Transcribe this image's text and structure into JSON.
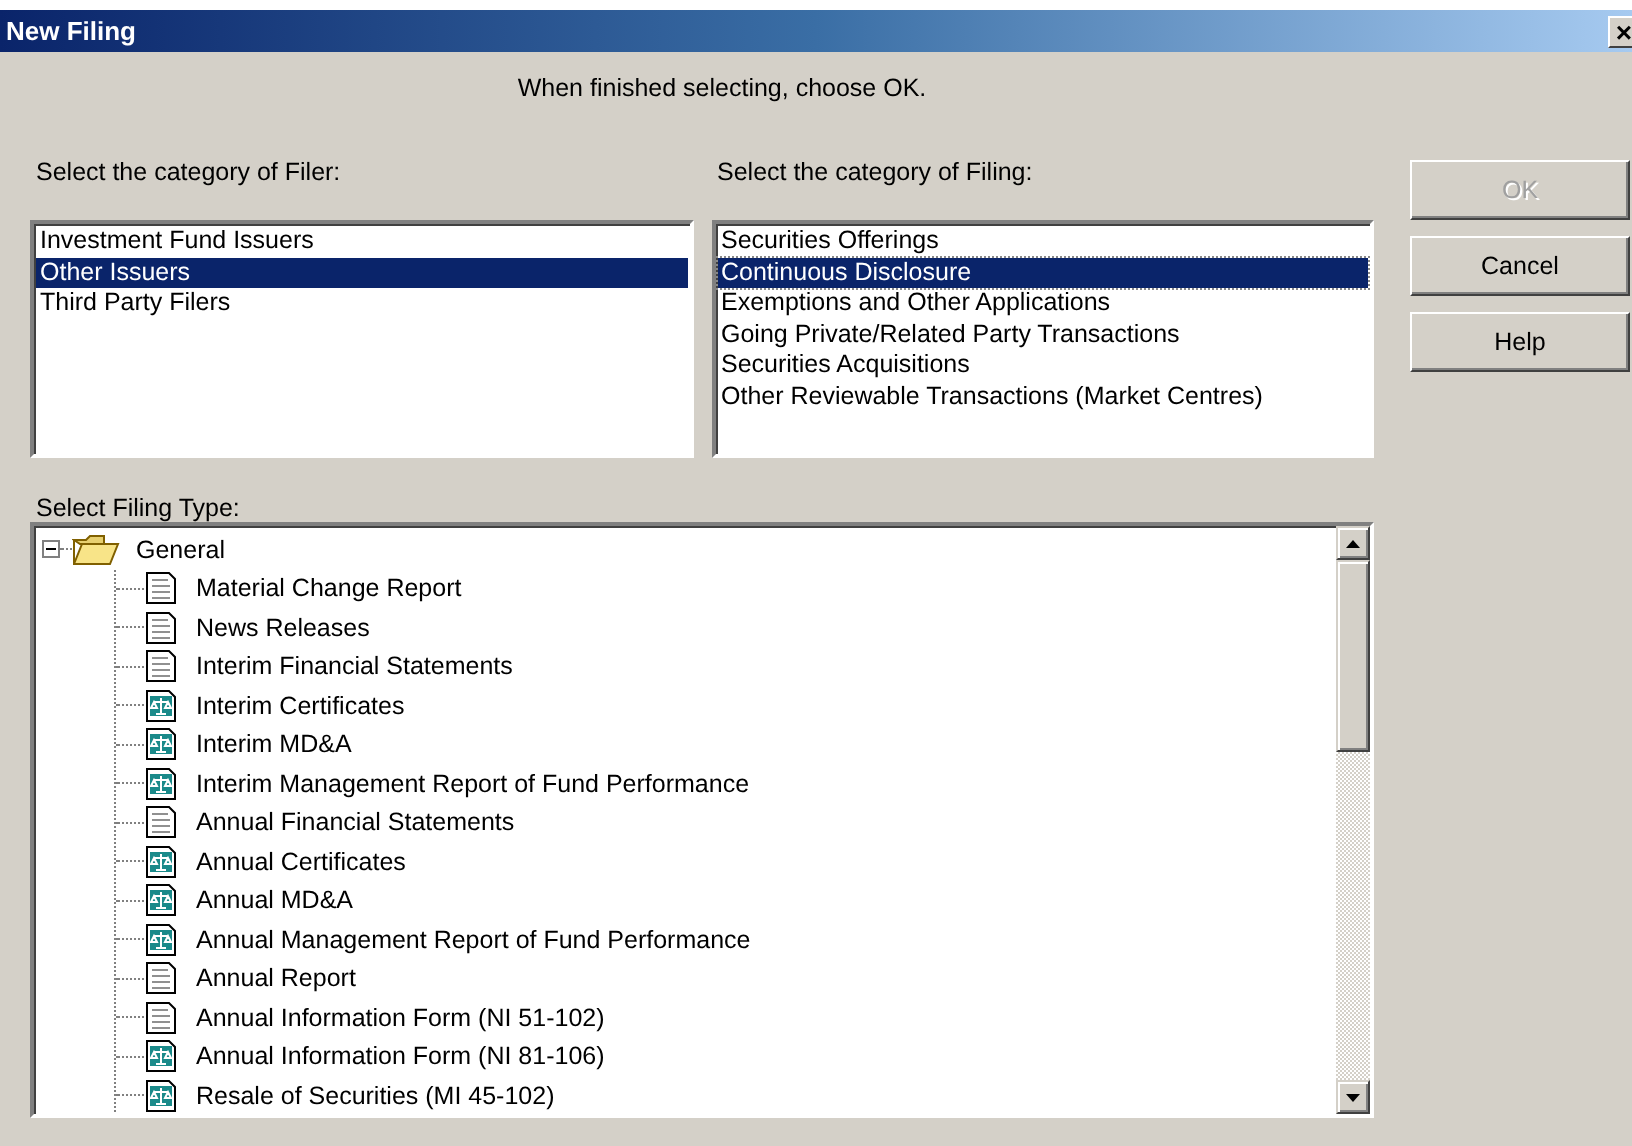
{
  "window": {
    "title": "New Filing",
    "close": "×"
  },
  "instruction": "When finished selecting, choose OK.",
  "filer": {
    "label": "Select the category of Filer:",
    "items": [
      {
        "label": "Investment Fund Issuers",
        "selected": false
      },
      {
        "label": "Other Issuers",
        "selected": true
      },
      {
        "label": "Third Party Filers",
        "selected": false
      }
    ]
  },
  "filing": {
    "label": "Select the category of Filing:",
    "items": [
      {
        "label": "Securities Offerings",
        "selected": false
      },
      {
        "label": "Continuous Disclosure",
        "selected": true
      },
      {
        "label": "Exemptions and Other Applications",
        "selected": false
      },
      {
        "label": "Going Private/Related Party Transactions",
        "selected": false
      },
      {
        "label": "Securities Acquisitions",
        "selected": false
      },
      {
        "label": "Other Reviewable Transactions (Market Centres)",
        "selected": false
      }
    ]
  },
  "buttons": [
    {
      "label": "OK",
      "disabled": true
    },
    {
      "label": "Cancel",
      "disabled": false
    },
    {
      "label": "Help",
      "disabled": false
    }
  ],
  "filing_type": {
    "label": "Select Filing Type:",
    "tree": [
      {
        "label": "General",
        "expanded": true,
        "children": [
          {
            "label": "Material Change Report",
            "kind": "document"
          },
          {
            "label": "News Releases",
            "kind": "document"
          },
          {
            "label": "Interim Financial Statements",
            "kind": "document"
          },
          {
            "label": "Interim Certificates",
            "kind": "certified"
          },
          {
            "label": "Interim MD&A",
            "kind": "certified"
          },
          {
            "label": "Interim Management Report of Fund Performance",
            "kind": "certified"
          },
          {
            "label": "Annual Financial Statements",
            "kind": "document"
          },
          {
            "label": "Annual Certificates",
            "kind": "certified"
          },
          {
            "label": "Annual MD&A",
            "kind": "certified"
          },
          {
            "label": "Annual Management Report of Fund Performance",
            "kind": "certified"
          },
          {
            "label": "Annual Report",
            "kind": "document"
          },
          {
            "label": "Annual Information Form (NI 51-102)",
            "kind": "document"
          },
          {
            "label": "Annual Information Form (NI 81-106)",
            "kind": "certified"
          },
          {
            "label": "Resale of Securities (MI 45-102)",
            "kind": "certified"
          }
        ]
      }
    ]
  }
}
